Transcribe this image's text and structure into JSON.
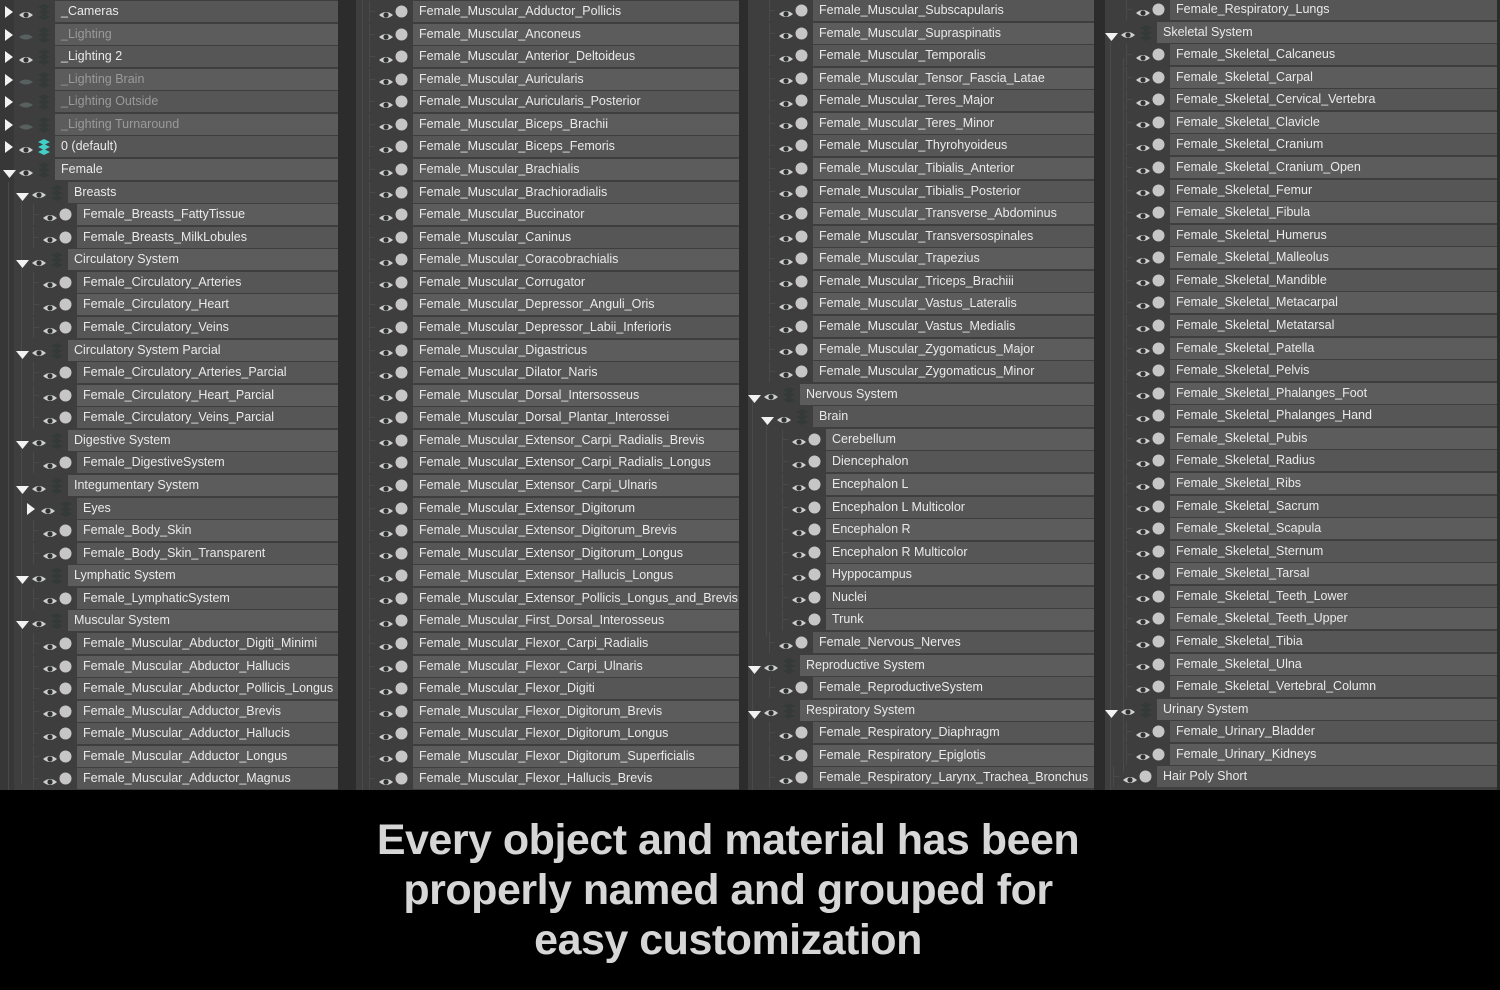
{
  "banner": {
    "lines": [
      "Every object and material has been",
      "properly named and grouped for",
      "easy customization"
    ]
  },
  "colors": {
    "panel_bg": "#3e3e3e",
    "row_bar": "#565656",
    "row_bar_alt": "#5c5c5c",
    "gutter": "#2c2c2c",
    "text": "#eaeaea",
    "text_disabled": "#9a9a9a",
    "accent_layer_cyan": "#41cfc7",
    "banner_bg": "#000000",
    "banner_text": "#d6d6d6"
  },
  "icons": {
    "expand_open": "triangle-down-icon",
    "expand_closed": "triangle-right-icon",
    "visible": "eye-open-icon",
    "hidden": "eye-closed-icon",
    "layer": "layer-stack-icon",
    "object": "object-dot-icon"
  },
  "outliner": {
    "columns": [
      {
        "rows": [
          {
            "l": 0,
            "k": "gc",
            "t": "_Cameras"
          },
          {
            "l": 0,
            "k": "gc",
            "t": "_Lighting",
            "h": 1
          },
          {
            "l": 0,
            "k": "gc",
            "t": "_Lighting 2"
          },
          {
            "l": 0,
            "k": "gc",
            "t": "_Lighting Brain",
            "h": 1
          },
          {
            "l": 0,
            "k": "gc",
            "t": "_Lighting Outside",
            "h": 1
          },
          {
            "l": 0,
            "k": "gc",
            "t": "_Lighting Turnaround",
            "h": 1
          },
          {
            "l": 0,
            "k": "gc",
            "t": "0 (default)",
            "c": 1
          },
          {
            "l": 0,
            "k": "ge",
            "t": "Female"
          },
          {
            "l": 1,
            "k": "ge",
            "t": "Breasts"
          },
          {
            "l": 2,
            "k": "o",
            "t": "Female_Breasts_FattyTissue"
          },
          {
            "l": 2,
            "k": "o",
            "t": "Female_Breasts_MilkLobules"
          },
          {
            "l": 1,
            "k": "ge",
            "t": "Circulatory System"
          },
          {
            "l": 2,
            "k": "o",
            "t": "Female_Circulatory_Arteries"
          },
          {
            "l": 2,
            "k": "o",
            "t": "Female_Circulatory_Heart"
          },
          {
            "l": 2,
            "k": "o",
            "t": "Female_Circulatory_Veins"
          },
          {
            "l": 1,
            "k": "ge",
            "t": "Circulatory System Parcial"
          },
          {
            "l": 2,
            "k": "o",
            "t": "Female_Circulatory_Arteries_Parcial"
          },
          {
            "l": 2,
            "k": "o",
            "t": "Female_Circulatory_Heart_Parcial"
          },
          {
            "l": 2,
            "k": "o",
            "t": "Female_Circulatory_Veins_Parcial"
          },
          {
            "l": 1,
            "k": "ge",
            "t": "Digestive System"
          },
          {
            "l": 2,
            "k": "o",
            "t": "Female_DigestiveSystem"
          },
          {
            "l": 1,
            "k": "ge",
            "t": "Integumentary System"
          },
          {
            "l": 2,
            "k": "gc",
            "t": "Eyes"
          },
          {
            "l": 2,
            "k": "o",
            "t": "Female_Body_Skin"
          },
          {
            "l": 2,
            "k": "o",
            "t": "Female_Body_Skin_Transparent"
          },
          {
            "l": 1,
            "k": "ge",
            "t": "Lymphatic System"
          },
          {
            "l": 2,
            "k": "o",
            "t": "Female_LymphaticSystem"
          },
          {
            "l": 1,
            "k": "ge",
            "t": "Muscular System"
          },
          {
            "l": 2,
            "k": "o",
            "t": "Female_Muscular_Abductor_Digiti_Minimi"
          },
          {
            "l": 2,
            "k": "o",
            "t": "Female_Muscular_Abductor_Hallucis"
          },
          {
            "l": 2,
            "k": "o",
            "t": "Female_Muscular_Abductor_Pollicis_Longus"
          },
          {
            "l": 2,
            "k": "o",
            "t": "Female_Muscular_Adductor_Brevis"
          },
          {
            "l": 2,
            "k": "o",
            "t": "Female_Muscular_Adductor_Hallucis"
          },
          {
            "l": 2,
            "k": "o",
            "t": "Female_Muscular_Adductor_Longus"
          },
          {
            "l": 2,
            "k": "o",
            "t": "Female_Muscular_Adductor_Magnus"
          }
        ]
      },
      {
        "rows": [
          {
            "l": 2,
            "k": "o",
            "t": "Female_Muscular_Adductor_Pollicis"
          },
          {
            "l": 2,
            "k": "o",
            "t": "Female_Muscular_Anconeus"
          },
          {
            "l": 2,
            "k": "o",
            "t": "Female_Muscular_Anterior_Deltoideus"
          },
          {
            "l": 2,
            "k": "o",
            "t": "Female_Muscular_Auricularis"
          },
          {
            "l": 2,
            "k": "o",
            "t": "Female_Muscular_Auricularis_Posterior"
          },
          {
            "l": 2,
            "k": "o",
            "t": "Female_Muscular_Biceps_Brachii"
          },
          {
            "l": 2,
            "k": "o",
            "t": "Female_Muscular_Biceps_Femoris"
          },
          {
            "l": 2,
            "k": "o",
            "t": "Female_Muscular_Brachialis"
          },
          {
            "l": 2,
            "k": "o",
            "t": "Female_Muscular_Brachioradialis"
          },
          {
            "l": 2,
            "k": "o",
            "t": "Female_Muscular_Buccinator"
          },
          {
            "l": 2,
            "k": "o",
            "t": "Female_Muscular_Caninus"
          },
          {
            "l": 2,
            "k": "o",
            "t": "Female_Muscular_Coracobrachialis"
          },
          {
            "l": 2,
            "k": "o",
            "t": "Female_Muscular_Corrugator"
          },
          {
            "l": 2,
            "k": "o",
            "t": "Female_Muscular_Depressor_Anguli_Oris"
          },
          {
            "l": 2,
            "k": "o",
            "t": "Female_Muscular_Depressor_Labii_Inferioris"
          },
          {
            "l": 2,
            "k": "o",
            "t": "Female_Muscular_Digastricus"
          },
          {
            "l": 2,
            "k": "o",
            "t": "Female_Muscular_Dilator_Naris"
          },
          {
            "l": 2,
            "k": "o",
            "t": "Female_Muscular_Dorsal_Intersosseus"
          },
          {
            "l": 2,
            "k": "o",
            "t": "Female_Muscular_Dorsal_Plantar_Interossei"
          },
          {
            "l": 2,
            "k": "o",
            "t": "Female_Muscular_Extensor_Carpi_Radialis_Brevis"
          },
          {
            "l": 2,
            "k": "o",
            "t": "Female_Muscular_Extensor_Carpi_Radialis_Longus"
          },
          {
            "l": 2,
            "k": "o",
            "t": "Female_Muscular_Extensor_Carpi_Ulnaris"
          },
          {
            "l": 2,
            "k": "o",
            "t": "Female_Muscular_Extensor_Digitorum"
          },
          {
            "l": 2,
            "k": "o",
            "t": "Female_Muscular_Extensor_Digitorum_Brevis"
          },
          {
            "l": 2,
            "k": "o",
            "t": "Female_Muscular_Extensor_Digitorum_Longus"
          },
          {
            "l": 2,
            "k": "o",
            "t": "Female_Muscular_Extensor_Hallucis_Longus"
          },
          {
            "l": 2,
            "k": "o",
            "t": "Female_Muscular_Extensor_Pollicis_Longus_and_Brevis"
          },
          {
            "l": 2,
            "k": "o",
            "t": "Female_Muscular_First_Dorsal_Interosseus"
          },
          {
            "l": 2,
            "k": "o",
            "t": "Female_Muscular_Flexor_Carpi_Radialis"
          },
          {
            "l": 2,
            "k": "o",
            "t": "Female_Muscular_Flexor_Carpi_Ulnaris"
          },
          {
            "l": 2,
            "k": "o",
            "t": "Female_Muscular_Flexor_Digiti"
          },
          {
            "l": 2,
            "k": "o",
            "t": "Female_Muscular_Flexor_Digitorum_Brevis"
          },
          {
            "l": 2,
            "k": "o",
            "t": "Female_Muscular_Flexor_Digitorum_Longus"
          },
          {
            "l": 2,
            "k": "o",
            "t": "Female_Muscular_Flexor_Digitorum_Superficialis"
          },
          {
            "l": 2,
            "k": "o",
            "t": "Female_Muscular_Flexor_Hallucis_Brevis"
          }
        ]
      },
      {
        "rows": [
          {
            "l": 2,
            "k": "o",
            "t": "Female_Muscular_Subscapularis"
          },
          {
            "l": 2,
            "k": "o",
            "t": "Female_Muscular_Supraspinatis"
          },
          {
            "l": 2,
            "k": "o",
            "t": "Female_Muscular_Temporalis"
          },
          {
            "l": 2,
            "k": "o",
            "t": "Female_Muscular_Tensor_Fascia_Latae"
          },
          {
            "l": 2,
            "k": "o",
            "t": "Female_Muscular_Teres_Major"
          },
          {
            "l": 2,
            "k": "o",
            "t": "Female_Muscular_Teres_Minor"
          },
          {
            "l": 2,
            "k": "o",
            "t": "Female_Muscular_Thyrohyoideus"
          },
          {
            "l": 2,
            "k": "o",
            "t": "Female_Muscular_Tibialis_Anterior"
          },
          {
            "l": 2,
            "k": "o",
            "t": "Female_Muscular_Tibialis_Posterior"
          },
          {
            "l": 2,
            "k": "o",
            "t": "Female_Muscular_Transverse_Abdominus"
          },
          {
            "l": 2,
            "k": "o",
            "t": "Female_Muscular_Transversospinales"
          },
          {
            "l": 2,
            "k": "o",
            "t": "Female_Muscular_Trapezius"
          },
          {
            "l": 2,
            "k": "o",
            "t": "Female_Muscular_Triceps_Brachiii"
          },
          {
            "l": 2,
            "k": "o",
            "t": "Female_Muscular_Vastus_Lateralis"
          },
          {
            "l": 2,
            "k": "o",
            "t": "Female_Muscular_Vastus_Medialis"
          },
          {
            "l": 2,
            "k": "o",
            "t": "Female_Muscular_Zygomaticus_Major"
          },
          {
            "l": 2,
            "k": "o",
            "t": "Female_Muscular_Zygomaticus_Minor"
          },
          {
            "l": 1,
            "k": "ge",
            "t": "Nervous System"
          },
          {
            "l": 2,
            "k": "ge",
            "t": "Brain"
          },
          {
            "l": 3,
            "k": "o",
            "t": "Cerebellum"
          },
          {
            "l": 3,
            "k": "o",
            "t": "Diencephalon"
          },
          {
            "l": 3,
            "k": "o",
            "t": "Encephalon L"
          },
          {
            "l": 3,
            "k": "o",
            "t": "Encephalon L Multicolor"
          },
          {
            "l": 3,
            "k": "o",
            "t": "Encephalon R"
          },
          {
            "l": 3,
            "k": "o",
            "t": "Encephalon R Multicolor"
          },
          {
            "l": 3,
            "k": "o",
            "t": "Hyppocampus"
          },
          {
            "l": 3,
            "k": "o",
            "t": "Nuclei"
          },
          {
            "l": 3,
            "k": "o",
            "t": "Trunk"
          },
          {
            "l": 2,
            "k": "o",
            "t": "Female_Nervous_Nerves"
          },
          {
            "l": 1,
            "k": "ge",
            "t": "Reproductive System"
          },
          {
            "l": 2,
            "k": "o",
            "t": "Female_ReproductiveSystem"
          },
          {
            "l": 1,
            "k": "ge",
            "t": "Respiratory System"
          },
          {
            "l": 2,
            "k": "o",
            "t": "Female_Respiratory_Diaphragm"
          },
          {
            "l": 2,
            "k": "o",
            "t": "Female_Respiratory_Epiglotis"
          },
          {
            "l": 2,
            "k": "o",
            "t": "Female_Respiratory_Larynx_Trachea_Bronchus"
          }
        ]
      },
      {
        "rows": [
          {
            "l": 2,
            "k": "o",
            "t": "Female_Respiratory_Lungs"
          },
          {
            "l": 1,
            "k": "ge",
            "t": "Skeletal System"
          },
          {
            "l": 2,
            "k": "o",
            "t": "Female_Skeletal_Calcaneus"
          },
          {
            "l": 2,
            "k": "o",
            "t": "Female_Skeletal_Carpal"
          },
          {
            "l": 2,
            "k": "o",
            "t": "Female_Skeletal_Cervical_Vertebra"
          },
          {
            "l": 2,
            "k": "o",
            "t": "Female_Skeletal_Clavicle"
          },
          {
            "l": 2,
            "k": "o",
            "t": "Female_Skeletal_Cranium"
          },
          {
            "l": 2,
            "k": "o",
            "t": "Female_Skeletal_Cranium_Open"
          },
          {
            "l": 2,
            "k": "o",
            "t": "Female_Skeletal_Femur"
          },
          {
            "l": 2,
            "k": "o",
            "t": "Female_Skeletal_Fibula"
          },
          {
            "l": 2,
            "k": "o",
            "t": "Female_Skeletal_Humerus"
          },
          {
            "l": 2,
            "k": "o",
            "t": "Female_Skeletal_Malleolus"
          },
          {
            "l": 2,
            "k": "o",
            "t": "Female_Skeletal_Mandible"
          },
          {
            "l": 2,
            "k": "o",
            "t": "Female_Skeletal_Metacarpal"
          },
          {
            "l": 2,
            "k": "o",
            "t": "Female_Skeletal_Metatarsal"
          },
          {
            "l": 2,
            "k": "o",
            "t": "Female_Skeletal_Patella"
          },
          {
            "l": 2,
            "k": "o",
            "t": "Female_Skeletal_Pelvis"
          },
          {
            "l": 2,
            "k": "o",
            "t": "Female_Skeletal_Phalanges_Foot"
          },
          {
            "l": 2,
            "k": "o",
            "t": "Female_Skeletal_Phalanges_Hand"
          },
          {
            "l": 2,
            "k": "o",
            "t": "Female_Skeletal_Pubis"
          },
          {
            "l": 2,
            "k": "o",
            "t": "Female_Skeletal_Radius"
          },
          {
            "l": 2,
            "k": "o",
            "t": "Female_Skeletal_Ribs"
          },
          {
            "l": 2,
            "k": "o",
            "t": "Female_Skeletal_Sacrum"
          },
          {
            "l": 2,
            "k": "o",
            "t": "Female_Skeletal_Scapula"
          },
          {
            "l": 2,
            "k": "o",
            "t": "Female_Skeletal_Sternum"
          },
          {
            "l": 2,
            "k": "o",
            "t": "Female_Skeletal_Tarsal"
          },
          {
            "l": 2,
            "k": "o",
            "t": "Female_Skeletal_Teeth_Lower"
          },
          {
            "l": 2,
            "k": "o",
            "t": "Female_Skeletal_Teeth_Upper"
          },
          {
            "l": 2,
            "k": "o",
            "t": "Female_Skeletal_Tibia"
          },
          {
            "l": 2,
            "k": "o",
            "t": "Female_Skeletal_Ulna"
          },
          {
            "l": 2,
            "k": "o",
            "t": "Female_Skeletal_Vertebral_Column"
          },
          {
            "l": 1,
            "k": "ge",
            "t": "Urinary System"
          },
          {
            "l": 2,
            "k": "o",
            "t": "Female_Urinary_Bladder"
          },
          {
            "l": 2,
            "k": "o",
            "t": "Female_Urinary_Kidneys"
          },
          {
            "l": 1,
            "k": "o",
            "t": "Hair Poly Short"
          }
        ]
      }
    ]
  }
}
